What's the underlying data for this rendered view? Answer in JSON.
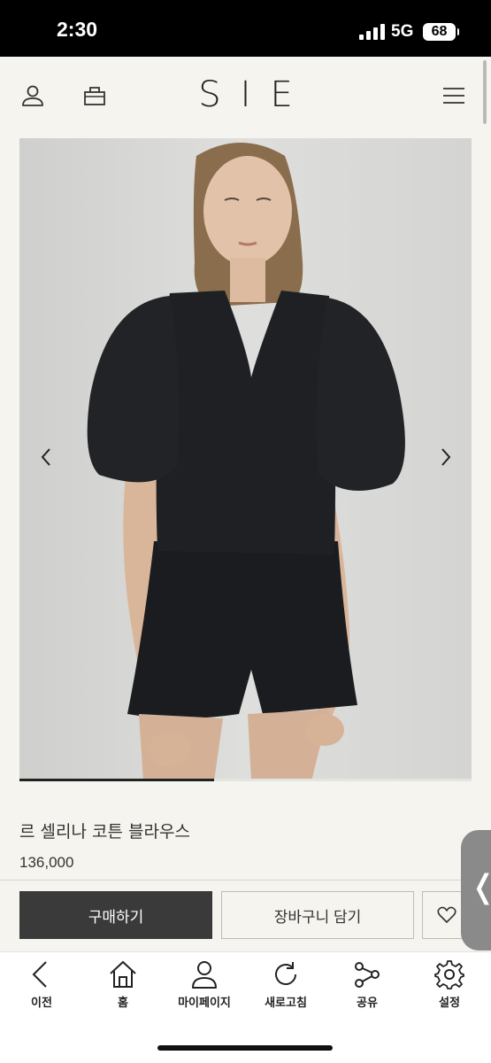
{
  "status_bar": {
    "time": "2:30",
    "network": "5G",
    "battery": "68"
  },
  "site": {
    "logo": "SIE"
  },
  "header": {
    "icons": [
      "user-icon",
      "shopping-bag-icon",
      "hamburger-menu-icon"
    ]
  },
  "product": {
    "name": "르 셀리나 코튼 블라우스",
    "price": "136,000",
    "image_progress": 0.43
  },
  "actions": {
    "buy_label": "구매하기",
    "cart_label": "장바구니 담기",
    "wishlist_icon": "heart-icon"
  },
  "side_handle": {
    "glyph": "❬"
  },
  "toolbar": {
    "items": [
      {
        "label": "이전",
        "icon": "back-arrow-icon"
      },
      {
        "label": "홈",
        "icon": "home-icon"
      },
      {
        "label": "마이페이지",
        "icon": "person-icon"
      },
      {
        "label": "새로고침",
        "icon": "refresh-icon"
      },
      {
        "label": "공유",
        "icon": "share-icon"
      },
      {
        "label": "설정",
        "icon": "settings-gear-icon"
      }
    ]
  }
}
